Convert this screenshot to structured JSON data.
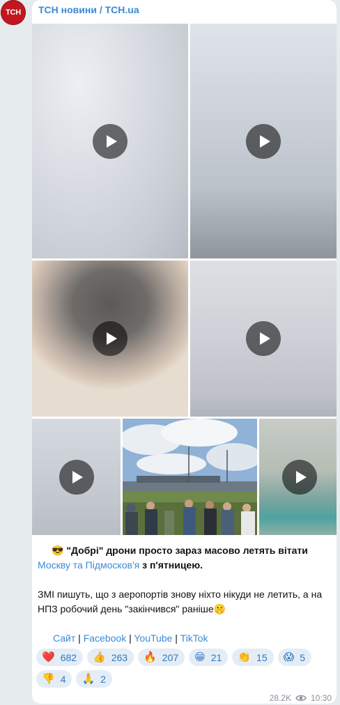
{
  "channel": {
    "avatar_text": "ТСН",
    "name": "ТСН новини / TCH.ua"
  },
  "media": [
    {
      "kind": "video",
      "blur": "sky"
    },
    {
      "kind": "video",
      "blur": "sky"
    },
    {
      "kind": "video",
      "blur": "head"
    },
    {
      "kind": "video",
      "blur": "sky"
    },
    {
      "kind": "video",
      "blur": "sky"
    },
    {
      "kind": "photo",
      "blur": "none"
    },
    {
      "kind": "video",
      "blur": "teal"
    }
  ],
  "caption": {
    "line1_emoji": "😎",
    "line1_text": " \"Добрі\" дрони просто зараз масово летять вітати",
    "line2_link": "Москву та Підмосков'я",
    "line2_text": " з п'ятницею.",
    "para2": "ЗМІ пишуть, що з аеропортів знову ніхто нікуди не летить, а на НПЗ робочий день \"закінчився\" раніше",
    "para2_emoji": "🤫",
    "links": {
      "site": "Сайт",
      "sep": " | ",
      "facebook": "Facebook",
      "youtube": "YouTube",
      "tiktok": "TikTok"
    }
  },
  "reactions": [
    {
      "emoji": "❤️",
      "count": "682"
    },
    {
      "emoji": "👍",
      "count": "263"
    },
    {
      "emoji": "🔥",
      "count": "207"
    },
    {
      "emoji": "😁",
      "count": "21"
    },
    {
      "emoji": "👏",
      "count": "15"
    },
    {
      "emoji": "😱",
      "count": "5"
    },
    {
      "emoji": "👎",
      "count": "4"
    },
    {
      "emoji": "🙏",
      "count": "2"
    }
  ],
  "meta": {
    "views": "28.2K",
    "time": "10:30"
  },
  "colors": {
    "accent": "#3a8ad4",
    "brand": "#c0181e"
  }
}
